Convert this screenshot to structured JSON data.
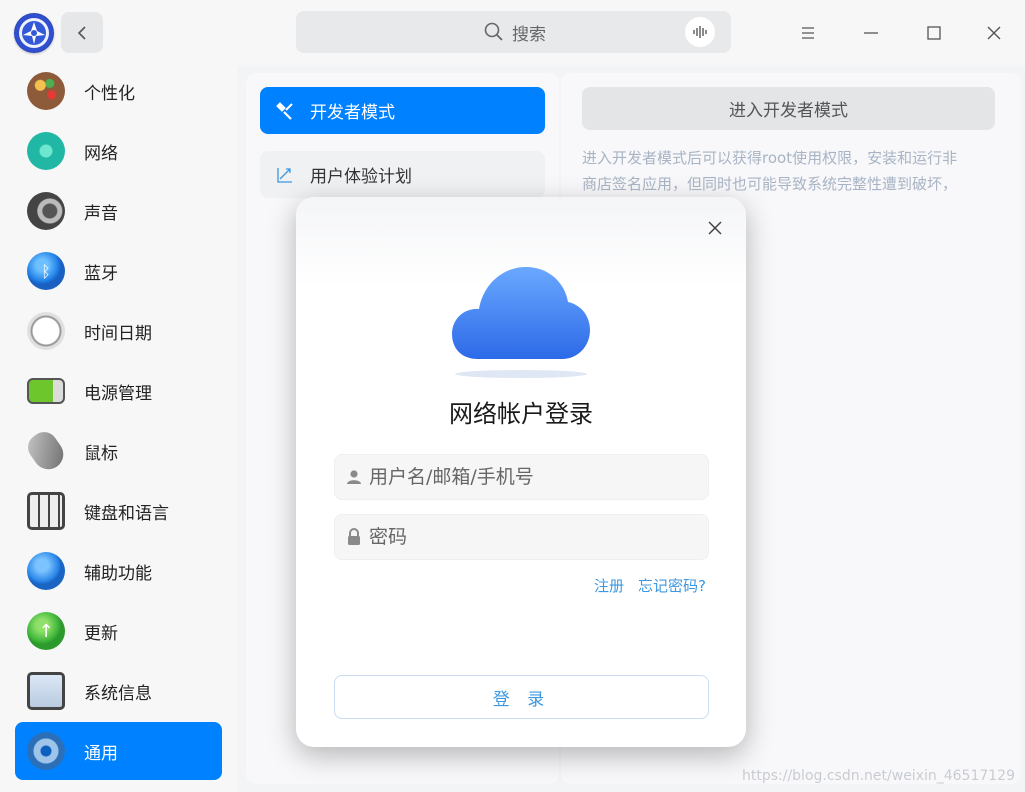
{
  "search": {
    "placeholder": "搜索"
  },
  "sidebar": {
    "items": [
      {
        "label": "个性化"
      },
      {
        "label": "网络"
      },
      {
        "label": "声音"
      },
      {
        "label": "蓝牙"
      },
      {
        "label": "时间日期"
      },
      {
        "label": "电源管理"
      },
      {
        "label": "鼠标"
      },
      {
        "label": "键盘和语言"
      },
      {
        "label": "辅助功能"
      },
      {
        "label": "更新"
      },
      {
        "label": "系统信息"
      },
      {
        "label": "通用"
      }
    ],
    "active_index": 11
  },
  "middle": {
    "items": [
      {
        "label": "开发者模式"
      },
      {
        "label": "用户体验计划"
      }
    ]
  },
  "right": {
    "dev_button": "进入开发者模式",
    "desc_line1": "进入开发者模式后可以获得root使用权限，安装和运行非",
    "desc_line2": "商店签名应用，但同时也可能导致系统完整性遭到破坏，"
  },
  "dialog": {
    "title": "网络帐户登录",
    "username_placeholder": "用户名/邮箱/手机号",
    "password_placeholder": "密码",
    "register_link": "注册",
    "forgot_link": "忘记密码?",
    "login_button": "登 录"
  },
  "watermark": "https://blog.csdn.net/weixin_46517129",
  "colors": {
    "accent": "#0081ff",
    "link": "#3d98e0",
    "cloud": "#3d7df0"
  }
}
